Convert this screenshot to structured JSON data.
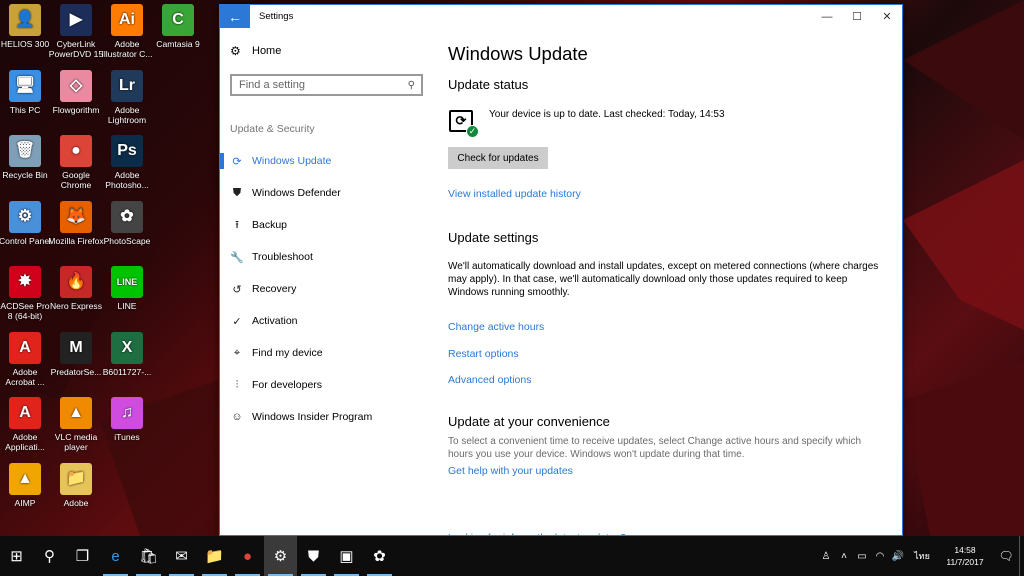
{
  "desktop": {
    "icons": [
      {
        "label": "HELIOS 300",
        "icon": "person-icon",
        "color": "#c9a13a",
        "glyph": "👤"
      },
      {
        "label": "CyberLink PowerDVD 15",
        "icon": "powerdvd-icon",
        "color": "#1c2d5a",
        "glyph": "▶"
      },
      {
        "label": "Adobe Illustrator C...",
        "icon": "illustrator-icon",
        "color": "#ff7c00",
        "glyph": "Ai"
      },
      {
        "label": "Camtasia 9",
        "icon": "camtasia-icon",
        "color": "#3aa537",
        "glyph": "C"
      },
      {
        "label": "This PC",
        "icon": "this-pc-icon",
        "color": "#3b8ee0",
        "glyph": "🖥"
      },
      {
        "label": "Flowgorithm",
        "icon": "flowgorithm-icon",
        "color": "#e98aa0",
        "glyph": "◇"
      },
      {
        "label": "Adobe Lightroom",
        "icon": "lightroom-icon",
        "color": "#1f3a5a",
        "glyph": "Lr"
      },
      {
        "label": "Recycle Bin",
        "icon": "recycle-bin-icon",
        "color": "#7f9fb8",
        "glyph": "🗑"
      },
      {
        "label": "Google Chrome",
        "icon": "chrome-icon",
        "color": "#db4437",
        "glyph": "●"
      },
      {
        "label": "Adobe Photosho...",
        "icon": "photoshop-icon",
        "color": "#0b2d4a",
        "glyph": "Ps"
      },
      {
        "label": "Control Panel",
        "icon": "control-panel-icon",
        "color": "#4a90d8",
        "glyph": "⚙"
      },
      {
        "label": "Mozilla Firefox",
        "icon": "firefox-icon",
        "color": "#e66000",
        "glyph": "🦊"
      },
      {
        "label": "PhotoScape",
        "icon": "photoscape-icon",
        "color": "#444444",
        "glyph": "✿"
      },
      {
        "label": "ACDSee Pro 8 (64-bit)",
        "icon": "acdsee-icon",
        "color": "#d0021b",
        "glyph": "✸"
      },
      {
        "label": "Nero Express",
        "icon": "nero-icon",
        "color": "#c62828",
        "glyph": "🔥"
      },
      {
        "label": "LINE",
        "icon": "line-icon",
        "color": "#00c300",
        "glyph": "LINE"
      },
      {
        "label": "Adobe Acrobat ...",
        "icon": "acrobat-icon",
        "color": "#e0241c",
        "glyph": "A"
      },
      {
        "label": "PredatorSe...",
        "icon": "predator-icon",
        "color": "#222222",
        "glyph": "M"
      },
      {
        "label": "B6011727-...",
        "icon": "excel-icon",
        "color": "#1d6f42",
        "glyph": "X"
      },
      {
        "label": "Adobe Applicati...",
        "icon": "adobe-icon",
        "color": "#e0241c",
        "glyph": "A"
      },
      {
        "label": "VLC media player",
        "icon": "vlc-icon",
        "color": "#f08a00",
        "glyph": "▲"
      },
      {
        "label": "iTunes",
        "icon": "itunes-icon",
        "color": "#d04ce0",
        "glyph": "♫"
      },
      {
        "label": "AIMP",
        "icon": "aimp-icon",
        "color": "#f0a500",
        "glyph": "▲"
      },
      {
        "label": "Adobe",
        "icon": "folder-icon",
        "color": "#e7c45a",
        "glyph": "📁"
      }
    ]
  },
  "window": {
    "title": "Settings",
    "back": "←",
    "minimize": "—",
    "maximize": "☐",
    "close": "✕"
  },
  "nav": {
    "home": "Home",
    "search_placeholder": "Find a setting",
    "section": "Update & Security",
    "items": [
      {
        "label": "Windows Update",
        "icon": "refresh-icon",
        "glyph": "⟳",
        "selected": true
      },
      {
        "label": "Windows Defender",
        "icon": "shield-icon",
        "glyph": "⛊"
      },
      {
        "label": "Backup",
        "icon": "backup-icon",
        "glyph": "⭱"
      },
      {
        "label": "Troubleshoot",
        "icon": "wrench-icon",
        "glyph": "🔧"
      },
      {
        "label": "Recovery",
        "icon": "recovery-icon",
        "glyph": "↺"
      },
      {
        "label": "Activation",
        "icon": "activation-icon",
        "glyph": "✓"
      },
      {
        "label": "Find my device",
        "icon": "find-device-icon",
        "glyph": "⌖"
      },
      {
        "label": "For developers",
        "icon": "developers-icon",
        "glyph": "⫶"
      },
      {
        "label": "Windows Insider Program",
        "icon": "insider-icon",
        "glyph": "☺"
      }
    ]
  },
  "main": {
    "title": "Windows Update",
    "status_heading": "Update status",
    "status_text": "Your device is up to date. Last checked: Today, 14:53",
    "check_button": "Check for updates",
    "history_link": "View installed update history",
    "settings_heading": "Update settings",
    "settings_text": "We'll automatically download and install updates, except on metered connections (where charges may apply). In that case, we'll automatically download only those updates required to keep Windows running smoothly.",
    "active_hours_link": "Change active hours",
    "restart_link": "Restart options",
    "advanced_link": "Advanced options",
    "convenience_heading": "Update at your convenience",
    "convenience_text": "To select a convenient time to receive updates, select Change active hours and specify which hours you use your device. Windows won't update during that time.",
    "help_link": "Get help with your updates",
    "cut_text": "Looking for info on the latest updates?"
  },
  "taskbar": {
    "items": [
      {
        "name": "start-icon",
        "glyph": "⊞"
      },
      {
        "name": "search-icon",
        "glyph": "⚲"
      },
      {
        "name": "task-view-icon",
        "glyph": "❐"
      },
      {
        "name": "edge-icon",
        "glyph": "e",
        "color": "#3a96dd"
      },
      {
        "name": "store-icon",
        "glyph": "🛍"
      },
      {
        "name": "mail-icon",
        "glyph": "✉"
      },
      {
        "name": "file-explorer-icon",
        "glyph": "📁"
      },
      {
        "name": "chrome-icon",
        "glyph": "●",
        "color": "#db4437"
      },
      {
        "name": "settings-icon",
        "glyph": "⚙",
        "active": true
      },
      {
        "name": "defender-icon",
        "glyph": "⛊"
      },
      {
        "name": "app-icon",
        "glyph": "▣"
      },
      {
        "name": "photoscape-icon",
        "glyph": "✿"
      }
    ],
    "tray": [
      "people-icon",
      "chevron-up-icon",
      "battery-icon",
      "wifi-icon",
      "volume-icon"
    ],
    "tray_glyphs": [
      "♙",
      "˄",
      "▭",
      "◠",
      "🔊"
    ],
    "lang": "ไทย",
    "time": "14:58",
    "date": "11/7/2017",
    "notif_glyph": "🗨"
  }
}
